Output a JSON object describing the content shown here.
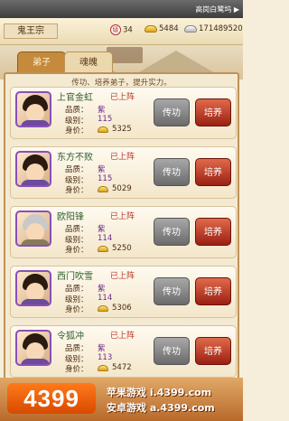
{
  "window": {
    "title": "高岗白鹭坞 ▶"
  },
  "header": {
    "sect_name": "鬼王宗",
    "resources": [
      {
        "icon": "token-icon",
        "glyph": "级",
        "value": "34"
      },
      {
        "icon": "gold-ingot-icon",
        "value": "5484"
      },
      {
        "icon": "silver-ingot-icon",
        "value": "171489520"
      }
    ]
  },
  "tabs": [
    {
      "label": "弟子",
      "active": true
    },
    {
      "label": "魂魄",
      "active": false
    }
  ],
  "subtitle": "传功、培养弟子，提升实力。",
  "labels": {
    "quality": "品质：",
    "level": "级别：",
    "price": "身价："
  },
  "disciples": [
    {
      "name": "上官金虹",
      "status": "已上阵",
      "quality": "紫",
      "level": "115",
      "price": "5325",
      "btn_transfer": "传功",
      "btn_train": "培养"
    },
    {
      "name": "东方不败",
      "status": "已上阵",
      "quality": "紫",
      "level": "115",
      "price": "5029",
      "btn_transfer": "传功",
      "btn_train": "培养"
    },
    {
      "name": "欧阳锋",
      "status": "已上阵",
      "quality": "紫",
      "level": "114",
      "price": "5250",
      "btn_transfer": "传功",
      "btn_train": "培养"
    },
    {
      "name": "西门吹雪",
      "status": "已上阵",
      "quality": "紫",
      "level": "114",
      "price": "5306",
      "btn_transfer": "传功",
      "btn_train": "培养"
    },
    {
      "name": "令狐冲",
      "status": "已上阵",
      "quality": "紫",
      "level": "113",
      "price": "5472",
      "btn_transfer": "传功",
      "btn_train": "培养"
    }
  ],
  "footer": {
    "logo": "4399",
    "line1": "苹果游戏 i.4399.com",
    "line2": "安卓游戏 a.4399.com"
  },
  "colors": {
    "accent": "#c58a3c",
    "train_button": "#b83a22",
    "transfer_button": "#8a8a8a",
    "quality_purple": "#8a4fb8"
  }
}
